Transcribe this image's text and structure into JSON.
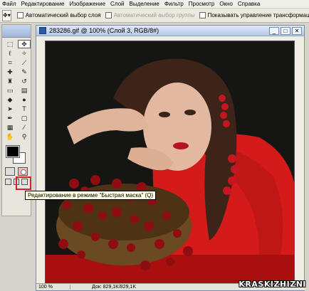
{
  "menu": [
    "Файл",
    "Редактирование",
    "Изображение",
    "Слой",
    "Выделение",
    "Фильтр",
    "Просмотр",
    "Окно",
    "Справка"
  ],
  "options": {
    "auto_select_layer": "Автоматический выбор слоя",
    "auto_select_group": "Автоматический выбор группы",
    "show_transform": "Показывать управление трансформацией"
  },
  "toolbox": {
    "tools": [
      "marquee-icon",
      "move-icon",
      "lasso-icon",
      "magic-wand-icon",
      "crop-icon",
      "slice-icon",
      "healing-icon",
      "brush-icon",
      "stamp-icon",
      "history-brush-icon",
      "eraser-icon",
      "gradient-icon",
      "blur-icon",
      "dodge-icon",
      "path-select-icon",
      "type-icon",
      "pen-icon",
      "shape-icon",
      "notes-icon",
      "eyedropper-icon",
      "hand-icon",
      "zoom-icon"
    ],
    "foreground_color": "#000000",
    "background_color": "#ffffff"
  },
  "tooltip": "Редактирование в режиме \"Быстрая маска\" (Q)",
  "document": {
    "title": "283286.gif @ 100% (Слой 3, RGB/8#)",
    "zoom": "100 %",
    "doc_size": "Док: 829,1K/829,1K"
  },
  "watermark": "KRASKIZHIZNI",
  "colors": {
    "highlight": "#d8202a",
    "dress": "#d51a1a",
    "berries": "#8e0d12"
  }
}
